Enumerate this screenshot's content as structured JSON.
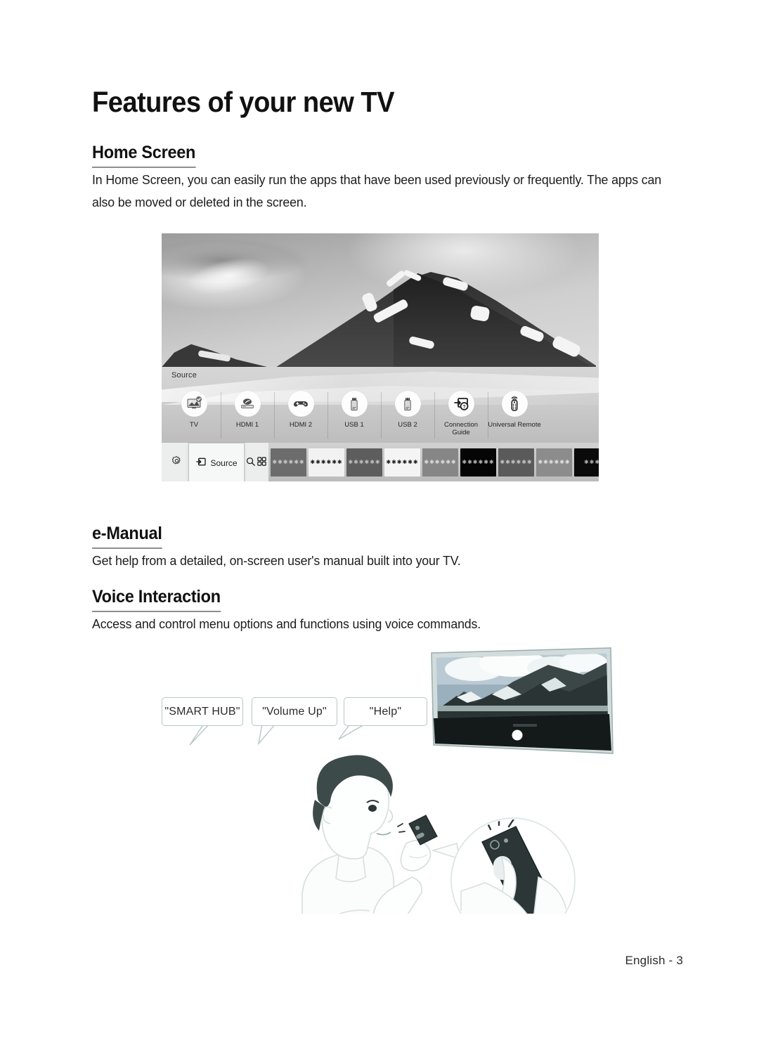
{
  "document": {
    "title": "Features of your new TV",
    "footer": "English - 3"
  },
  "sections": [
    {
      "heading": "Home Screen",
      "body": "In Home Screen, you can easily run the apps that have been used previously or frequently. The apps can also be moved or deleted in the screen."
    },
    {
      "heading": "e-Manual",
      "body": "Get help from a detailed, on-screen user's manual built into your TV."
    },
    {
      "heading": "Voice Interaction",
      "body": "Access and control menu options and functions using voice commands."
    }
  ],
  "home_screen_figure": {
    "source_label": "Source",
    "sources": [
      {
        "label": "TV",
        "icon": "tv-icon"
      },
      {
        "label": "HDMI 1",
        "icon": "bluray-player-icon"
      },
      {
        "label": "HDMI 2",
        "icon": "game-controller-icon"
      },
      {
        "label": "USB 1",
        "icon": "usb-drive-icon"
      },
      {
        "label": "USB 2",
        "icon": "usb-drive-icon"
      },
      {
        "label": "Connection Guide",
        "icon": "connection-guide-icon"
      },
      {
        "label": "Universal Remote",
        "icon": "universal-remote-icon"
      }
    ],
    "toolbar": {
      "settings_icon": "gear-icon",
      "source_button": "Source",
      "source_button_icon": "source-input-icon",
      "search_icon": "search-icon",
      "apps_icon": "apps-grid-icon"
    },
    "app_tiles": [
      {
        "placeholder": "✱✱✱✱✱✱",
        "bg": "#6c6c6c",
        "fg": "#c9c9c9"
      },
      {
        "placeholder": "✱✱✱✱✱✱",
        "bg": "#f2f2f2",
        "fg": "#1a1a1a"
      },
      {
        "placeholder": "✱✱✱✱✱✱",
        "bg": "#5d5d5d",
        "fg": "#bfbfbf"
      },
      {
        "placeholder": "✱✱✱✱✱✱",
        "bg": "#f4f4f4",
        "fg": "#1a1a1a"
      },
      {
        "placeholder": "✱✱✱✱✱✱",
        "bg": "#868686",
        "fg": "#dcdcdc"
      },
      {
        "placeholder": "✱✱✱✱✱✱",
        "bg": "#050505",
        "fg": "#b5b5b5"
      },
      {
        "placeholder": "✱✱✱✱✱✱",
        "bg": "#5a5a5a",
        "fg": "#c2c2c2"
      },
      {
        "placeholder": "✱✱✱✱✱✱",
        "bg": "#8c8c8c",
        "fg": "#e0e0e0"
      },
      {
        "placeholder": "✱✱✱",
        "bg": "#0a0a0a",
        "fg": "#b0b0b0"
      }
    ]
  },
  "voice_figure": {
    "bubbles": [
      "\"SMART HUB\"",
      "\"Volume Up\"",
      "\"Help\""
    ]
  },
  "colors": {
    "heading_rule": "#8e8e8e",
    "bubble_border": "#b9c7c7",
    "text": "#1a1a1a",
    "page_bg": "#ffffff"
  }
}
